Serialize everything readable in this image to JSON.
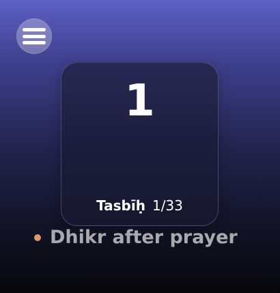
{
  "menu": {
    "icon": "hamburger-menu-icon"
  },
  "counter": {
    "value": "1",
    "dhikr_name": "Tasbīḥ",
    "progress_text": "1/33",
    "progress": {
      "current": 1,
      "total": 33
    }
  },
  "subtitle": {
    "text": "Dhikr after prayer",
    "bullet_color": "#d99a6c"
  },
  "colors": {
    "background_top": "#5d5fc3",
    "background_bottom": "#070709",
    "card_background": "#1c1d3c",
    "count_text": "#ffffff",
    "subtitle_text": "#a9a9ae"
  }
}
